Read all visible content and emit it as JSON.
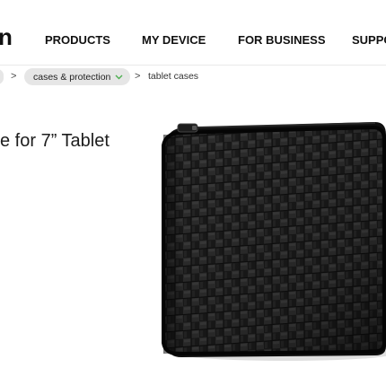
{
  "nav": {
    "logo_fragment": "n",
    "items": [
      {
        "label": "PRODUCTS"
      },
      {
        "label": "MY DEVICE"
      },
      {
        "label": "FOR BUSINESS"
      },
      {
        "label": "SUPPO"
      }
    ]
  },
  "breadcrumb": {
    "separator": ">",
    "category": "cases & protection",
    "current": "tablet cases",
    "chevron_icon": "chevron-down-icon",
    "chevron_color": "#4caf50"
  },
  "product": {
    "title_fragment": "e for 7” Tablet",
    "image": "woven-black-tablet-sleeve"
  },
  "colors": {
    "pill_bg": "#e6e6e6",
    "text": "#111111"
  }
}
